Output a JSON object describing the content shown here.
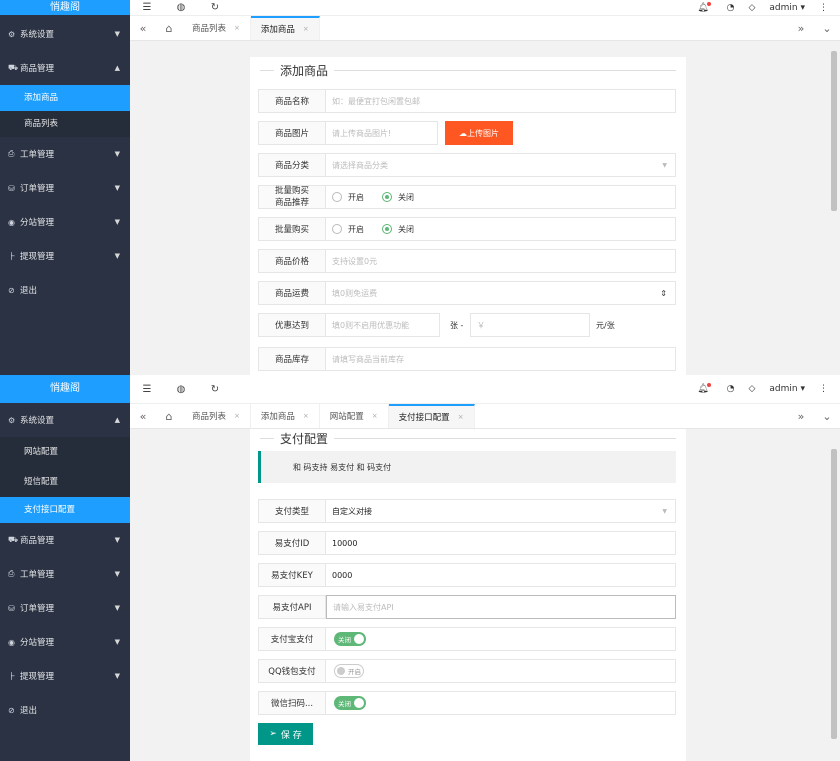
{
  "top": {
    "logo": "悄趣阁",
    "sidebar": [
      {
        "icon": "⚙",
        "label": "系统设置",
        "arrow": "▼"
      },
      {
        "icon": "⛟",
        "label": "商品管理",
        "arrow": "▲"
      },
      {
        "icon": "⎙",
        "label": "工单管理",
        "arrow": "▼"
      },
      {
        "icon": "⛁",
        "label": "订单管理",
        "arrow": "▼"
      },
      {
        "icon": "◉",
        "label": "分站管理",
        "arrow": "▼"
      },
      {
        "icon": "⺊",
        "label": "提现管理",
        "arrow": "▼"
      },
      {
        "icon": "⊘",
        "label": "退出",
        "arrow": ""
      }
    ],
    "subitems": [
      "添加商品",
      "商品列表"
    ],
    "user": "admin ▾",
    "tabs": [
      {
        "label": "商品列表",
        "x": "×"
      },
      {
        "label": "添加商品",
        "x": "×"
      }
    ],
    "form_title": "添加商品",
    "fields": {
      "name_label": "商品名称",
      "name_ph": "如：最便宜打包闲置包邮",
      "image_label": "商品图片",
      "image_ph": "请上传商品图片!",
      "upload": "上传图片",
      "cat_label": "商品分类",
      "cat_ph": "请选择商品分类",
      "rec_label_a": "批量购买",
      "rec_label_b": "商品推荐",
      "radio_on": "开启",
      "radio_off": "关闭",
      "bulk_label": "批量购买",
      "price_label": "商品价格",
      "price_ph": "支持设置0元",
      "ship_label": "商品运费",
      "ship_ph": "填0则免运费",
      "disc_label": "优惠达到",
      "disc_ph": "填0则不启用优惠功能",
      "disc_unit1": "张 -",
      "disc_ph2": "￥",
      "disc_unit2": "元/张",
      "stock_label": "商品库存",
      "stock_ph": "请填写商品当前库存"
    }
  },
  "bottom": {
    "logo": "悄趣阁",
    "sidebar_top": {
      "icon": "⚙",
      "label": "系统设置",
      "arrow": "▲"
    },
    "subitems": [
      "网站配置",
      "短信配置",
      "支付接口配置"
    ],
    "sidebar": [
      {
        "icon": "⛟",
        "label": "商品管理",
        "arrow": "▼"
      },
      {
        "icon": "⎙",
        "label": "工单管理",
        "arrow": "▼"
      },
      {
        "icon": "⛁",
        "label": "订单管理",
        "arrow": "▼"
      },
      {
        "icon": "◉",
        "label": "分站管理",
        "arrow": "▼"
      },
      {
        "icon": "⺊",
        "label": "提现管理",
        "arrow": "▼"
      },
      {
        "icon": "⊘",
        "label": "退出",
        "arrow": ""
      }
    ],
    "user": "admin ▾",
    "tabs": [
      {
        "label": "商品列表",
        "x": "×"
      },
      {
        "label": "添加商品",
        "x": "×"
      },
      {
        "label": "网站配置",
        "x": "×"
      },
      {
        "label": "支付接口配置",
        "x": "×"
      }
    ],
    "form_title": "支付配置",
    "notice": "和 码支持 易支付 和 码支付",
    "fields": {
      "type_label": "支付类型",
      "type_val": "自定义对接",
      "id_label": "易支付ID",
      "id_val": "10000",
      "key_label": "易支付KEY",
      "key_val": "0000",
      "api_label": "易支付API",
      "api_ph": "请输入易支付API",
      "ali_label": "支付宝支付",
      "ali_sw": "关闭",
      "qq_label": "QQ钱包支付",
      "qq_sw": "开启",
      "wx_label": "微信扫码...",
      "wx_sw": "关闭"
    },
    "save": "保 存"
  }
}
